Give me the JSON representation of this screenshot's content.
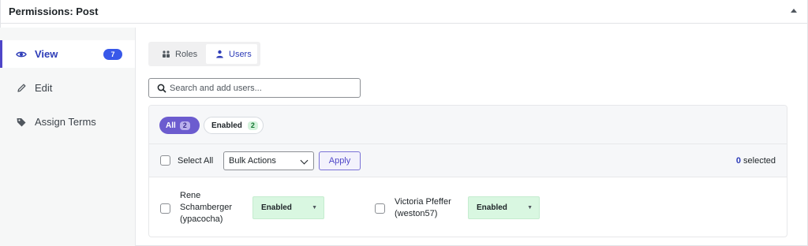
{
  "header": {
    "title": "Permissions: Post"
  },
  "sidebar": {
    "items": [
      {
        "label": "View",
        "icon": "eye-icon",
        "count": "7"
      },
      {
        "label": "Edit",
        "icon": "pencil-icon"
      },
      {
        "label": "Assign Terms",
        "icon": "tag-icon"
      }
    ]
  },
  "tabs": {
    "roles": "Roles",
    "users": "Users"
  },
  "search": {
    "placeholder": "Search and add users..."
  },
  "filters": {
    "all": {
      "label": "All",
      "count": "2"
    },
    "enabled": {
      "label": "Enabled",
      "count": "2"
    }
  },
  "actions": {
    "select_all": "Select All",
    "bulk_value": "Bulk Actions",
    "apply": "Apply",
    "selected_count": "0",
    "selected_label": " selected"
  },
  "users": [
    {
      "name": "Rene Schamberger (ypacocha)",
      "status": "Enabled"
    },
    {
      "name": "Victoria Pfeffer (weston57)",
      "status": "Enabled"
    }
  ],
  "colors": {
    "accent": "#4f46c8",
    "badge": "#3858e9",
    "enabled_bg": "#d9f7e1"
  }
}
